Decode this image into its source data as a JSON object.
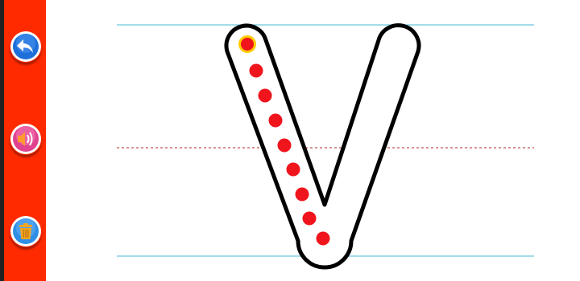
{
  "app": {
    "sidebar": {
      "buttons": [
        {
          "name": "back-button",
          "icon": "back-arrow-icon",
          "color": "#1e6fd9"
        },
        {
          "name": "sound-button",
          "icon": "speaker-icon",
          "color": "#e0428f"
        },
        {
          "name": "clear-button",
          "icon": "trash-icon",
          "color": "#2f8fe6"
        }
      ]
    },
    "colors": {
      "sidebar": "#ff2a00",
      "sidebar_edge": "#222222",
      "guide_line": "#6cc6de",
      "midline": "#c0504d",
      "letter_outline": "#000000",
      "trace_dot": "#f0141c",
      "start_dot": "#f0141c",
      "start_dot_ring": "#ffcc00"
    },
    "tracing": {
      "letter": "V",
      "stroke_count": 1,
      "dots_in_stroke": 9,
      "start_marker_count": 1
    }
  }
}
